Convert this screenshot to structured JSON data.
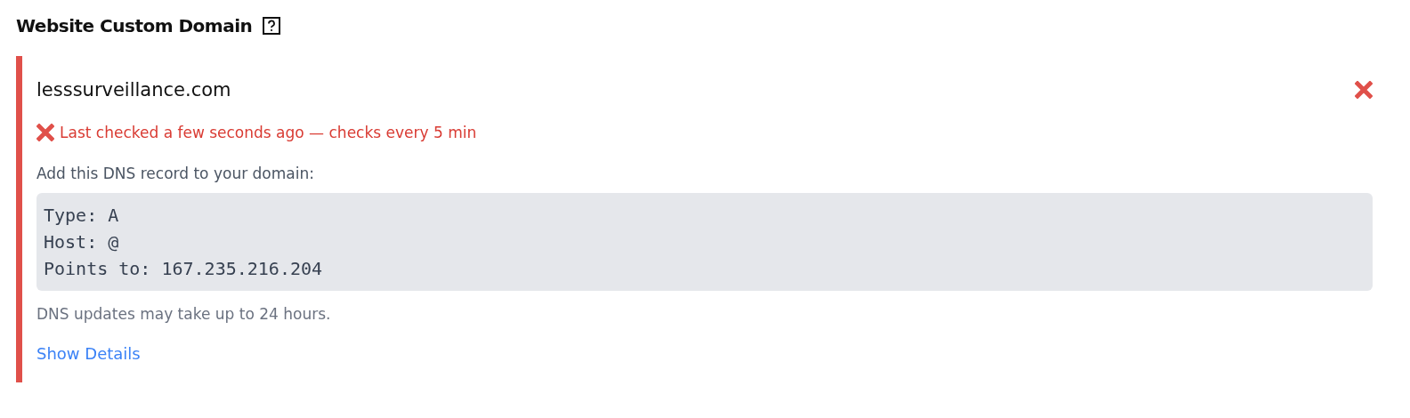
{
  "section": {
    "title": "Website Custom Domain"
  },
  "domain": {
    "name": "lesssurveillance.com",
    "failed": true,
    "status_text": "Last checked a few seconds ago — checks every 5 min",
    "instruction": "Add this DNS record to your domain:",
    "record_lines": [
      "Type: A",
      "Host: @",
      "Points to: 167.235.216.204"
    ],
    "note": "DNS updates may take up to 24 hours.",
    "link": "Show Details"
  }
}
